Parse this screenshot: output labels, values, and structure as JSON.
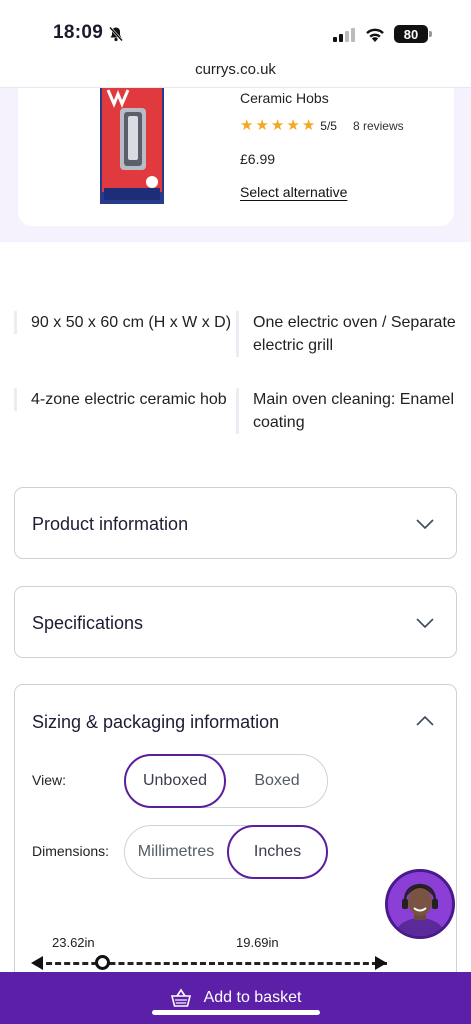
{
  "status_bar": {
    "time": "18:09",
    "battery": "80"
  },
  "browser": {
    "url": "currys.co.uk"
  },
  "alternative_product": {
    "title": "Ceramic Hobs",
    "rating_value": 5,
    "rating_text": "5/5",
    "reviews": "8 reviews",
    "price": "£6.99",
    "select_label": "Select alternative"
  },
  "features": [
    "90 x 50 x 60 cm (H x W x D)",
    "One electric oven / Separate electric grill",
    "4-zone electric ceramic hob",
    "Main oven cleaning: Enamel coating"
  ],
  "accordions": {
    "product_info": "Product information",
    "specifications": "Specifications",
    "sizing": "Sizing & packaging information"
  },
  "sizing": {
    "view_label": "View:",
    "view_options": [
      "Unboxed",
      "Boxed"
    ],
    "view_selected": "Unboxed",
    "dimensions_label": "Dimensions:",
    "dimension_options": [
      "Millimetres",
      "Inches"
    ],
    "dimension_selected": "Inches",
    "depth_value": "23.62in",
    "width_value": "19.69in"
  },
  "basket": {
    "label": "Add to basket"
  },
  "colors": {
    "brand_purple": "#5c1fa8",
    "star": "#f5a623",
    "section_bg": "#f6f2fd"
  }
}
